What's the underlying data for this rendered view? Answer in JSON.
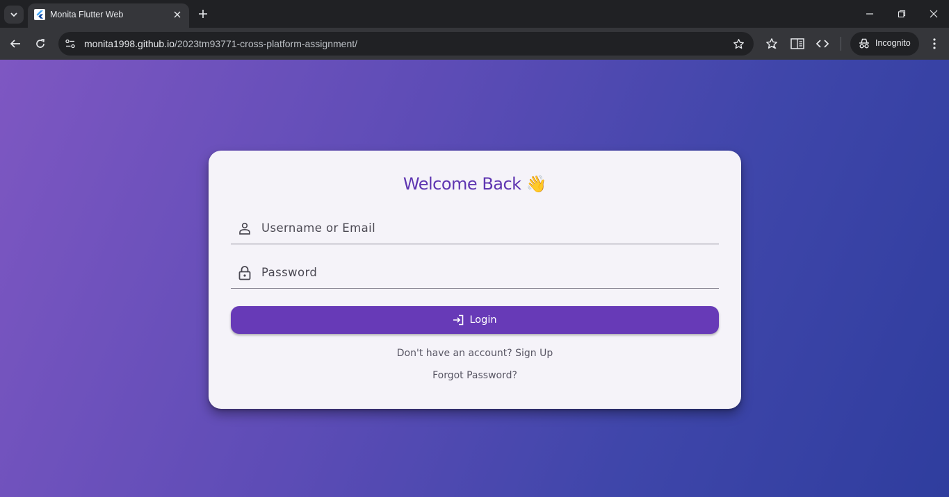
{
  "browser": {
    "tab": {
      "title": "Monita Flutter Web"
    },
    "url": {
      "host": "monita1998.github.io",
      "path": "/2023tm93771-cross-platform-assignment/"
    },
    "incognito_label": "Incognito",
    "icons": [
      "tab-search-icon",
      "flutter-icon",
      "close-icon",
      "plus-icon",
      "minimize-icon",
      "restore-icon",
      "window-close-icon",
      "back-icon",
      "reload-icon",
      "site-info-icon",
      "star-icon",
      "bookmarks-icon",
      "reading-list-icon",
      "devtools-icon",
      "incognito-icon",
      "more-icon"
    ]
  },
  "login": {
    "title": "Welcome Back 👋",
    "username_label": "Username or Email",
    "password_label": "Password",
    "login_button": "Login",
    "signup_link": "Don't have an account? Sign Up",
    "forgot_link": "Forgot Password?"
  },
  "colors": {
    "accent": "#673ab7",
    "title": "#5e35b1",
    "gradient_start": "#7e57c2",
    "gradient_end": "#2f3d9e",
    "card": "#f5f3f9"
  }
}
